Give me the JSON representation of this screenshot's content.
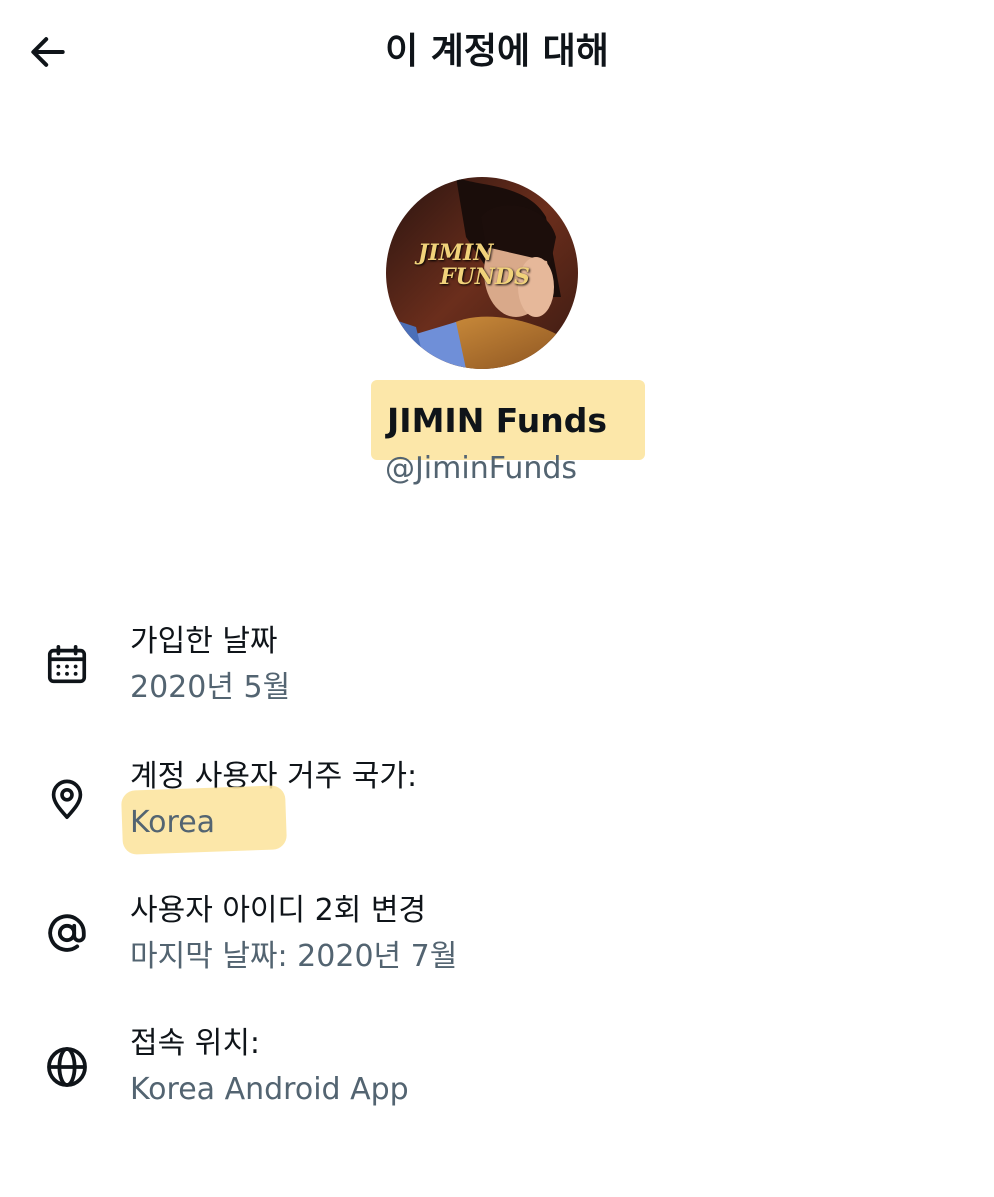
{
  "header": {
    "title": "이 계정에 대해"
  },
  "profile": {
    "avatar_text_line1": "JIMIN",
    "avatar_text_line2": "FUNDS",
    "display_name": "JIMIN Funds",
    "handle": "@JiminFunds"
  },
  "info": [
    {
      "icon": "calendar-icon",
      "label": "가입한 날짜",
      "value": "2020년 5월"
    },
    {
      "icon": "location-pin-icon",
      "label": "계정 사용자 거주 국가:",
      "value": "Korea"
    },
    {
      "icon": "at-sign-icon",
      "label": "사용자 아이디 2회 변경",
      "value": "마지막 날짜: 2020년 7월"
    },
    {
      "icon": "globe-icon",
      "label": "접속 위치:",
      "value": "Korea Android App"
    }
  ],
  "colors": {
    "highlight": "#fbe39a",
    "primary_text": "#0f1419",
    "secondary_text": "#536471"
  }
}
